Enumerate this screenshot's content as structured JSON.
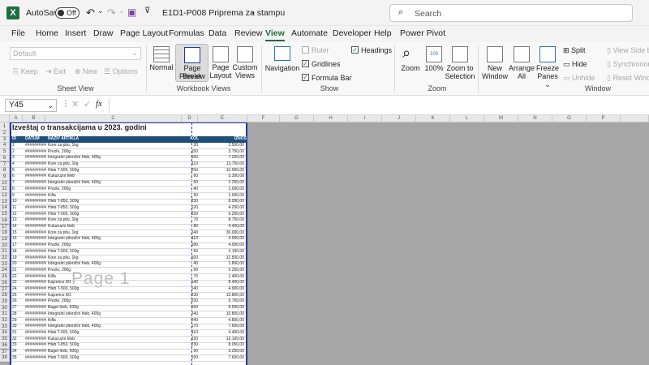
{
  "titlebar": {
    "autosave_label": "AutoSave",
    "autosave_state": "Off",
    "document_title": "E1D1-P008 Priprema za stampu",
    "search_placeholder": "Search"
  },
  "menu": [
    "File",
    "Home",
    "Insert",
    "Draw",
    "Page Layout",
    "Formulas",
    "Data",
    "Review",
    "View",
    "Automate",
    "Developer",
    "Help",
    "Power Pivot"
  ],
  "menu_active": "View",
  "ribbon": {
    "sheet_view": {
      "dropdown": "Default",
      "keep": "Keep",
      "exit": "Exit",
      "new": "New",
      "options": "Options",
      "group": "Sheet View"
    },
    "workbook_views": {
      "normal": "Normal",
      "page_break_1": "Page Break",
      "page_break_2": "Preview",
      "page_layout_1": "Page",
      "page_layout_2": "Layout",
      "custom_1": "Custom",
      "custom_2": "Views",
      "group": "Workbook Views"
    },
    "show": {
      "navigation": "Navigation",
      "ruler": "Ruler",
      "gridlines": "Gridlines",
      "formula_bar": "Formula Bar",
      "headings": "Headings",
      "group": "Show"
    },
    "zoom": {
      "zoom": "Zoom",
      "hundred": "100%",
      "zoom_sel_1": "Zoom to",
      "zoom_sel_2": "Selection",
      "group": "Zoom"
    },
    "window": {
      "new_1": "New",
      "new_2": "Window",
      "arrange_1": "Arrange",
      "arrange_2": "All",
      "freeze_1": "Freeze",
      "freeze_2": "Panes",
      "split": "Split",
      "hide": "Hide",
      "unhide": "Unhide",
      "view_side": "View Side b",
      "synchronous": "Synchronou",
      "reset": "Reset Windo",
      "group": "Window"
    }
  },
  "formula": {
    "namebox": "Y45",
    "fx": "fx"
  },
  "columns": [
    "A",
    "B",
    "C",
    "D",
    "E",
    "F",
    "G",
    "H",
    "I",
    "J",
    "K",
    "L",
    "M",
    "N",
    "O",
    "P"
  ],
  "sheet": {
    "title": "Izveštaj o transakcijama u 2023. godini",
    "headers": [
      "ID",
      "DATUM",
      "NAZIV ARTIKLA",
      "KOL",
      "IZNOS"
    ],
    "watermark": "Page 1",
    "date_mask": "##########",
    "rows": [
      [
        "1",
        "Kore za pitu, 1kg",
        "20",
        "2.500,00"
      ],
      [
        "2",
        "Prezle, 200g",
        "150",
        "3.750,00"
      ],
      [
        "3",
        "Integralni pšenični hleb, 400g",
        "160",
        "7.200,00"
      ],
      [
        "4",
        "Kore za pitu, 1kg",
        "110",
        "13.750,00"
      ],
      [
        "5",
        "Hleb T-500, 500g",
        "250",
        "10.000,00"
      ],
      [
        "6",
        "Kukuruzni hleb",
        "60",
        "3.300,00"
      ],
      [
        "7",
        "Integralni pšenični hleb, 400g",
        "50",
        "2.250,00"
      ],
      [
        "8",
        "Prezle, 200g",
        "40",
        "1.000,00"
      ],
      [
        "9",
        "Kifla",
        "50",
        "1.000,00"
      ],
      [
        "10",
        "Hleb T-850, 500g",
        "230",
        "8.050,00"
      ],
      [
        "11",
        "Hleb T-850, 500g",
        "120",
        "4.200,00"
      ],
      [
        "12",
        "Hleb T-500, 500g",
        "230",
        "9.200,00"
      ],
      [
        "13",
        "Kore za pitu, 1kg",
        "70",
        "8.750,00"
      ],
      [
        "14",
        "Kukuruzni hleb",
        "80",
        "4.400,00"
      ],
      [
        "15",
        "Kore za pitu, 1kg",
        "240",
        "30.000,00"
      ],
      [
        "16",
        "Integralni pšenični hleb, 400g",
        "110",
        "4.950,00"
      ],
      [
        "17",
        "Prezle, 200g",
        "180",
        "4.500,00"
      ],
      [
        "18",
        "Hleb T-500, 500g",
        "60",
        "2.100,00"
      ],
      [
        "19",
        "Kore za pitu, 1kg",
        "100",
        "12.500,00"
      ],
      [
        "20",
        "Integralni pšenični hleb, 400g",
        "40",
        "1.800,00"
      ],
      [
        "21",
        "Prezle, 200g",
        "90",
        "2.250,00"
      ],
      [
        "22",
        "Kifla",
        "70",
        "1.400,00"
      ],
      [
        "23",
        "Kajzerice 8/1",
        "140",
        "8.400,00"
      ],
      [
        "24",
        "Hleb T-500, 500g",
        "140",
        "4.900,00"
      ],
      [
        "25",
        "Kajzerice 8/1",
        "230",
        "13.800,00"
      ],
      [
        "26",
        "Prezle, 200g",
        "230",
        "5.750,00"
      ],
      [
        "27",
        "Baget hleb, 500g",
        "190",
        "8.550,00"
      ],
      [
        "28",
        "Integralni pšenični hleb, 400g",
        "240",
        "10.800,00"
      ],
      [
        "29",
        "Kifla",
        "240",
        "4.800,00"
      ],
      [
        "30",
        "Integralni pšenični hleb, 400g",
        "170",
        "7.650,00"
      ],
      [
        "31",
        "Hleb T-500, 500g",
        "110",
        "4.400,00"
      ],
      [
        "32",
        "Kukuruzni hleb",
        "220",
        "12.100,00"
      ],
      [
        "33",
        "Hleb T-850, 500g",
        "230",
        "8.050,00"
      ],
      [
        "34",
        "Baget hleb, 500g",
        "50",
        "2.250,00"
      ],
      [
        "35",
        "Hleb T-500, 500g",
        "190",
        "7.600,00"
      ]
    ]
  },
  "colors": {
    "accent": "#1d6f42",
    "header_fill": "#1f4e79",
    "page_border": "#1f3aa8",
    "off_page": "#a6a6a6"
  }
}
